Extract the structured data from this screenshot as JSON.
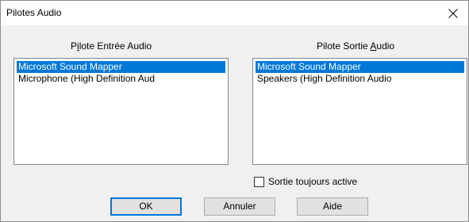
{
  "window": {
    "title": "Pilotes Audio",
    "close_icon": "close-icon"
  },
  "input": {
    "label_pre": "P",
    "label_u": "i",
    "label_post": "lote Entrée Audio",
    "items": [
      {
        "label": "Microsoft Sound Mapper",
        "selected": true
      },
      {
        "label": "Microphone (High Definition Aud",
        "selected": false
      }
    ]
  },
  "output": {
    "label_pre": "Pilote Sortie ",
    "label_u": "A",
    "label_post": "udio",
    "items": [
      {
        "label": "Microsoft Sound Mapper",
        "selected": true
      },
      {
        "label": "Speakers (High Definition Audio",
        "selected": false
      }
    ]
  },
  "always_active": {
    "label": "Sortie toujours active",
    "checked": false
  },
  "buttons": {
    "ok": "OK",
    "cancel": "Annuler",
    "help": "Aide"
  },
  "colors": {
    "selection": "#0078d7",
    "default_button_border": "#0078d7"
  }
}
